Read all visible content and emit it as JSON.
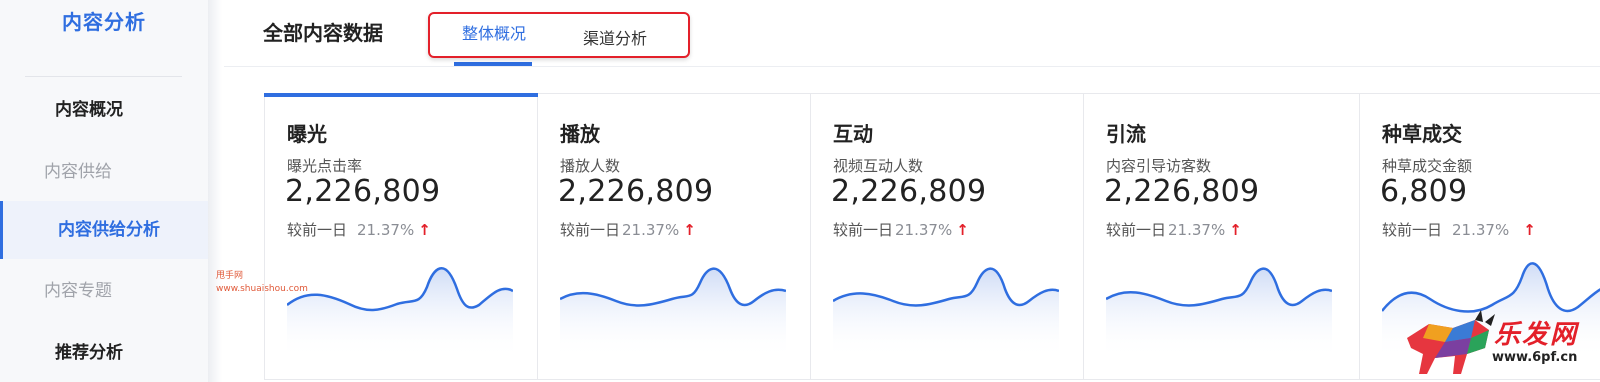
{
  "sidebar": {
    "title": "内容分析",
    "items": [
      {
        "label": "内容概况",
        "state": "strong"
      },
      {
        "label": "内容供给",
        "state": "muted"
      },
      {
        "label": "内容供给分析",
        "state": "active"
      },
      {
        "label": "内容专题",
        "state": "muted"
      },
      {
        "label": "推荐分析",
        "state": "strong"
      }
    ],
    "watermark": [
      "甩手网",
      "www.shuaishou.com"
    ]
  },
  "header": {
    "title": "全部内容数据",
    "tabs": [
      {
        "label": "整体概况",
        "active": true
      },
      {
        "label": "渠道分析",
        "active": false
      }
    ]
  },
  "cards": [
    {
      "title": "曝光",
      "metric": "曝光点击率",
      "value": "2,226,809",
      "compare_label": "较前一日",
      "compare_pct": "21.37%",
      "trend_icon": "arrow-up-icon"
    },
    {
      "title": "播放",
      "metric": "播放人数",
      "value": "2,226,809",
      "compare_label": "较前一日",
      "compare_pct": "21.37%",
      "trend_icon": "arrow-up-icon"
    },
    {
      "title": "互动",
      "metric": "视频互动人数",
      "value": "2,226,809",
      "compare_label": "较前一日",
      "compare_pct": "21.37%",
      "trend_icon": "arrow-up-icon"
    },
    {
      "title": "引流",
      "metric": "内容引导访客数",
      "value": "2,226,809",
      "compare_label": "较前一日",
      "compare_pct": "21.37%",
      "trend_icon": "arrow-up-icon"
    },
    {
      "title": "种草成交",
      "metric": "种草成交金额",
      "value": "6,809",
      "compare_label": "较前一日",
      "compare_pct": "21.37%",
      "trend_icon": "arrow-up-icon"
    }
  ],
  "logo": {
    "text": "乐发网",
    "url": "www.6pf.cn"
  },
  "colors": {
    "accent": "#2f6ee0",
    "highlight": "#e3202a",
    "trend_up": "#e3202a"
  }
}
